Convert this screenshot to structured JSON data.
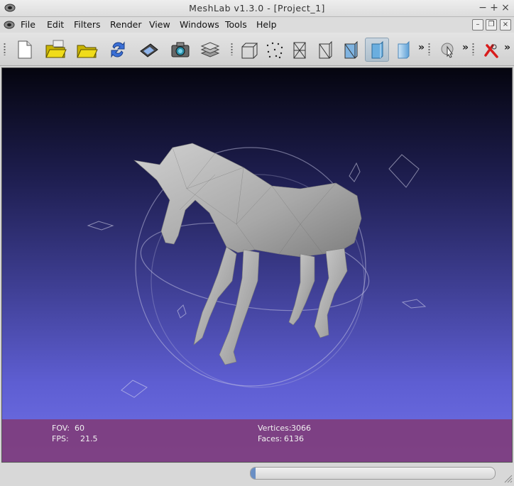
{
  "window": {
    "title": "MeshLab v1.3.0 - [Project_1]"
  },
  "menu": {
    "items": [
      {
        "label": "File"
      },
      {
        "label": "Edit"
      },
      {
        "label": "Filters"
      },
      {
        "label": "Render"
      },
      {
        "label": "View"
      },
      {
        "label": "Windows"
      },
      {
        "label": "Tools"
      },
      {
        "label": "Help"
      }
    ]
  },
  "toolbar": {
    "more_glyph": "»",
    "buttons": [
      "new-document-icon",
      "open-folder-icon",
      "open-project-icon",
      "reload-icon",
      "save-icon",
      "snapshot-camera-icon",
      "layers-icon",
      "bounding-box-icon",
      "points-icon",
      "wireframe-icon",
      "hidden-lines-icon",
      "flat-lines-icon",
      "flat-shading-icon",
      "smooth-shading-icon",
      "pick-tool-icon",
      "delete-tool-icon"
    ]
  },
  "viewport": {
    "fov_label": "FOV:",
    "fov_value": "60",
    "fps_label": "FPS:",
    "fps_value": "21.5",
    "vertices_label": "Vertices:",
    "vertices_value": "3066",
    "faces_label": "Faces:",
    "faces_value": "6136"
  },
  "status": {
    "progress_fraction": 0.01
  },
  "colors": {
    "panel": "#803c7a",
    "bg_top": "#05050f",
    "bg_bottom": "#7070e6"
  }
}
